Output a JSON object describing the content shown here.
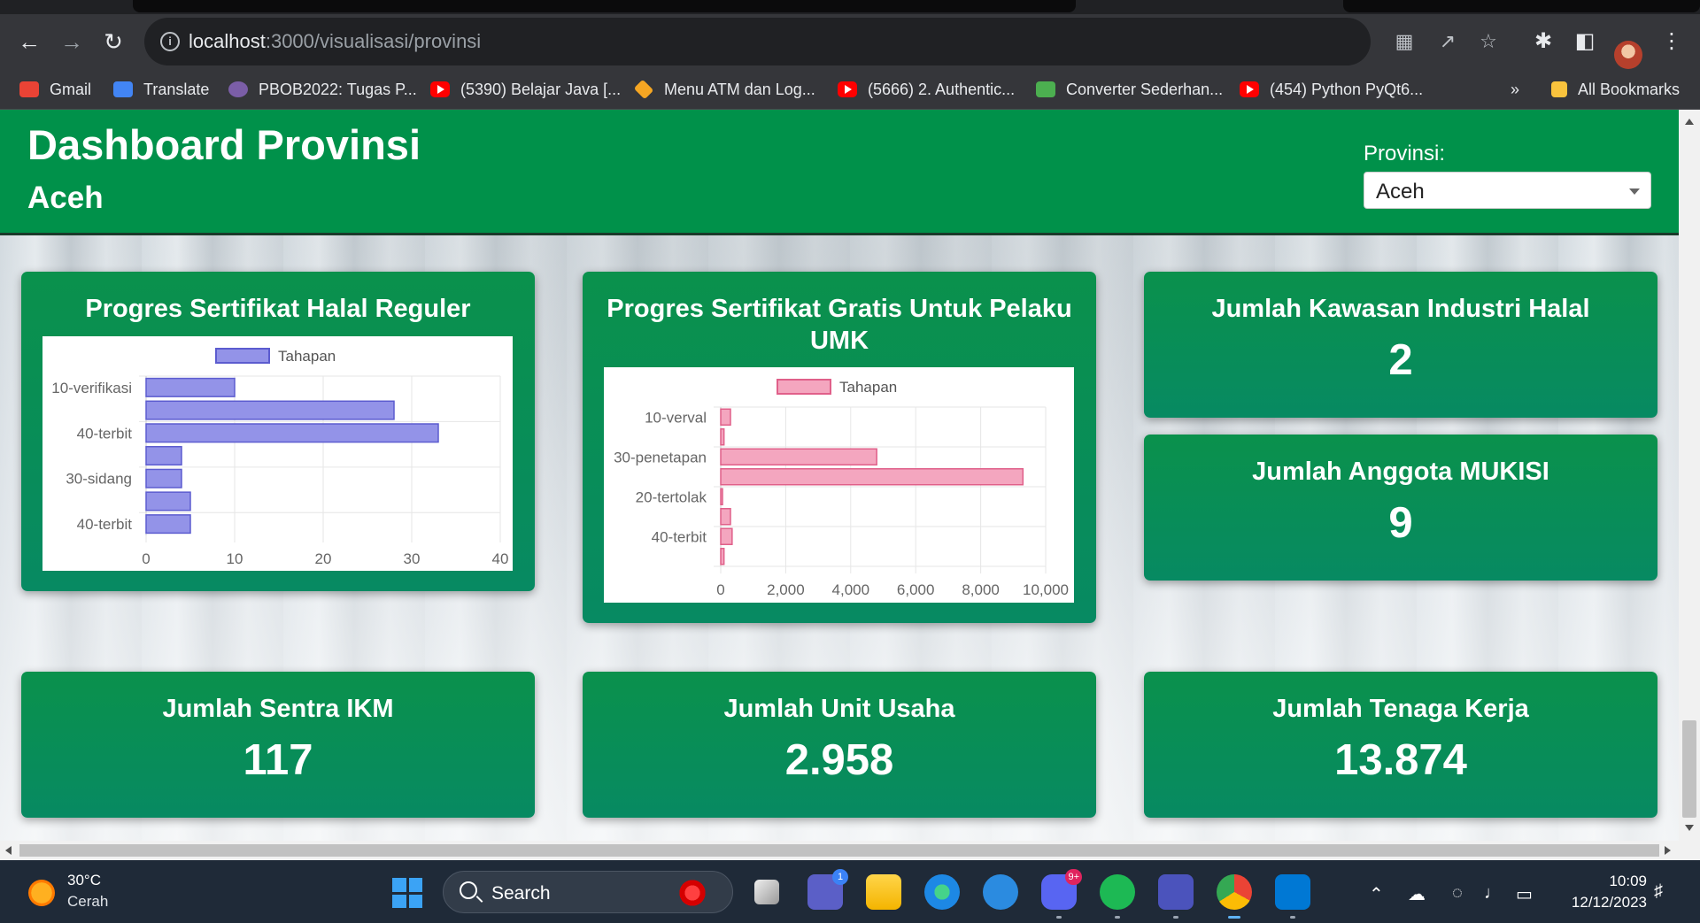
{
  "browser": {
    "url_host": "localhost",
    "url_path": ":3000/visualisasi/provinsi",
    "bookmarks": [
      {
        "label": "Gmail",
        "icon": "gmail-icon",
        "color": "#ea4335"
      },
      {
        "label": "Translate",
        "icon": "translate-icon",
        "color": "#4285f4"
      },
      {
        "label": "PBOB2022: Tugas P...",
        "icon": "moodle-icon",
        "color": "#7b5ea7"
      },
      {
        "label": "(5390) Belajar Java [...",
        "icon": "youtube-icon",
        "color": "#ff0000"
      },
      {
        "label": "Menu ATM dan Log...",
        "icon": "package-icon",
        "color": "#f5a623"
      },
      {
        "label": "(5666) 2. Authentic...",
        "icon": "youtube-icon",
        "color": "#ff0000"
      },
      {
        "label": "Converter Sederhan...",
        "icon": "cube-icon",
        "color": "#4caf50"
      },
      {
        "label": "(454) Python PyQt6...",
        "icon": "youtube-icon",
        "color": "#ff0000"
      }
    ],
    "overflow_label": "»",
    "all_bookmarks_label": "All Bookmarks"
  },
  "header": {
    "title": "Dashboard Provinsi",
    "subtitle": "Aceh",
    "province_label": "Provinsi:",
    "province_selected": "Aceh",
    "color": "#00914a"
  },
  "cards": {
    "halal_reguler": {
      "title": "Progres Sertifikat Halal Reguler"
    },
    "gratis_umk": {
      "title": "Progres Sertifikat Gratis Untuk Pelaku UMK"
    },
    "kawasan": {
      "title": "Jumlah Kawasan Industri Halal",
      "value": "2"
    },
    "mukisi": {
      "title": "Jumlah Anggota MUKISI",
      "value": "9"
    },
    "sentra_ikm": {
      "title": "Jumlah Sentra IKM",
      "value": "117"
    },
    "unit_usaha": {
      "title": "Jumlah Unit Usaha",
      "value": "2.958"
    },
    "tenaga_kerja": {
      "title": "Jumlah Tenaga Kerja",
      "value": "13.874"
    }
  },
  "chart_data": [
    {
      "type": "bar",
      "orientation": "horizontal",
      "title": "Progres Sertifikat Halal Reguler",
      "legend": "Tahapan",
      "legend_position": "top",
      "categories": [
        "10-verifikasi",
        "",
        "40-terbit",
        "",
        "30-sidang",
        "",
        "40-terbit"
      ],
      "values": [
        10,
        28,
        33,
        4,
        4,
        5,
        5
      ],
      "xlim": [
        0,
        40
      ],
      "xticks": [
        "0",
        "10",
        "20",
        "30",
        "40"
      ],
      "xtick_values": [
        0,
        10,
        20,
        30,
        40
      ],
      "fill": "#9393e8",
      "stroke": "#5c5ccf",
      "grid": true
    },
    {
      "type": "bar",
      "orientation": "horizontal",
      "title": "Progres Sertifikat Gratis Untuk Pelaku UMK",
      "legend": "Tahapan",
      "legend_position": "top",
      "categories": [
        "10-verval",
        "",
        "30-penetapan",
        "",
        "20-tertolak",
        "",
        "40-terbit",
        ""
      ],
      "values": [
        300,
        100,
        4800,
        9300,
        50,
        300,
        350,
        100
      ],
      "xlim": [
        0,
        10000
      ],
      "xticks": [
        "0",
        "2,000",
        "4,000",
        "6,000",
        "8,000",
        "10,000"
      ],
      "xtick_values": [
        0,
        2000,
        4000,
        6000,
        8000,
        10000
      ],
      "fill": "#f4a6bf",
      "stroke": "#e0608a",
      "grid": true
    }
  ],
  "taskbar": {
    "temperature": "30°C",
    "weather": "Cerah",
    "search_label": "Search",
    "time": "10:09",
    "date": "12/12/2023",
    "teams_badge": "1",
    "discord_badge": "9+"
  }
}
